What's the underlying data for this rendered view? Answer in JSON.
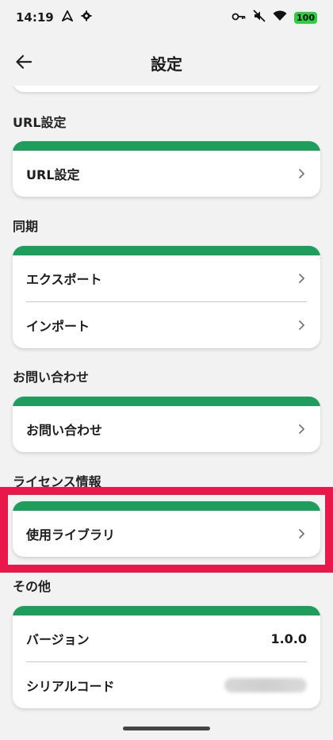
{
  "status_bar": {
    "time": "14:19",
    "battery": "100"
  },
  "header": {
    "title": "設定"
  },
  "sections": [
    {
      "title": "URL設定",
      "rows": [
        {
          "label": "URL設定"
        }
      ]
    },
    {
      "title": "同期",
      "rows": [
        {
          "label": "エクスポート"
        },
        {
          "label": "インポート"
        }
      ]
    },
    {
      "title": "お問い合わせ",
      "rows": [
        {
          "label": "お問い合わせ"
        }
      ]
    },
    {
      "title": "ライセンス情報",
      "rows": [
        {
          "label": "使用ライブラリ"
        }
      ]
    },
    {
      "title": "その他",
      "rows": [
        {
          "label": "バージョン",
          "value": "1.0.0"
        },
        {
          "label": "シリアルコード"
        }
      ]
    }
  ],
  "colors": {
    "accent_green": "#1f9d5d",
    "highlight_red": "#e8194a",
    "background": "#f2f2f2"
  },
  "icons": {
    "back": "arrow-left",
    "chevron": "chevron-right",
    "status": [
      "location-icon",
      "gear-icon",
      "key-icon",
      "mute-icon",
      "wifi-icon",
      "battery-icon"
    ]
  }
}
